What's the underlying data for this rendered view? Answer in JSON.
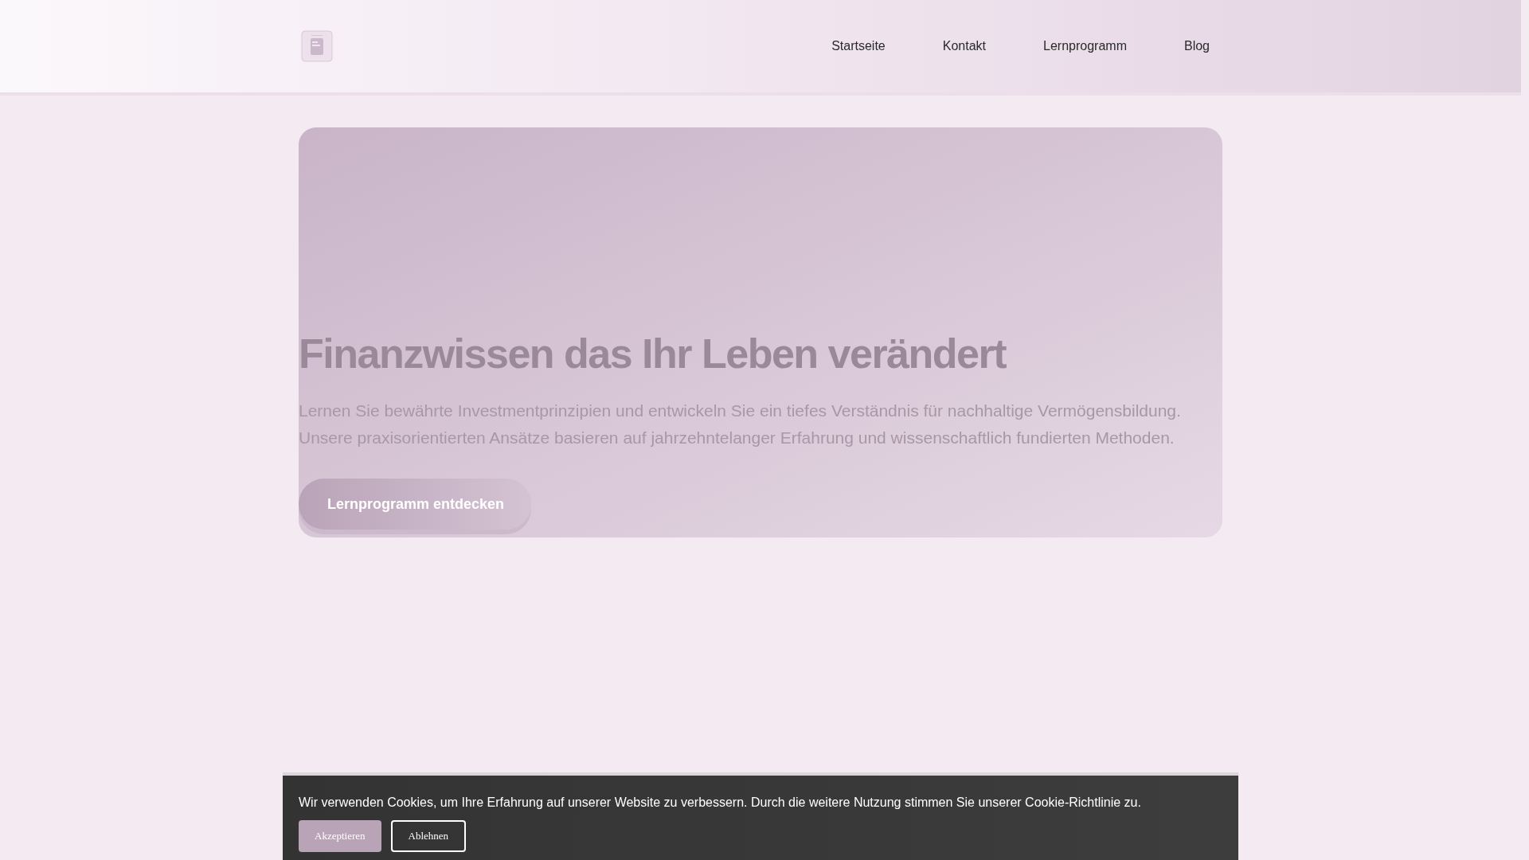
{
  "header": {
    "nav": [
      {
        "label": "Startseite"
      },
      {
        "label": "Kontakt"
      },
      {
        "label": "Lernprogramm"
      },
      {
        "label": "Blog"
      }
    ]
  },
  "hero": {
    "title": "Finanzwissen das Ihr Leben verändert",
    "lines": [
      "Lernen Sie bewährte Investmentprinzipien und entwickeln Sie ein tiefes Verständnis für nachhaltige Vermögensbildung.",
      "Unsere praxisorientierten Ansätze basieren auf jahrzehntelanger Erfahrung und wissenschaftlich fundierten Methoden."
    ],
    "button": "Lernprogramm entdecken"
  },
  "cookie_banner": {
    "text": "Wir verwenden Cookies, um Ihre Erfahrung auf unserer Website zu verbessern. Durch die weitere Nutzung stimmen Sie unserer Cookie-Richtlinie zu.",
    "buttons": [
      {
        "label": "Akzeptieren",
        "kind": "primary"
      },
      {
        "label": "Ablehnen",
        "kind": "outline"
      }
    ]
  }
}
